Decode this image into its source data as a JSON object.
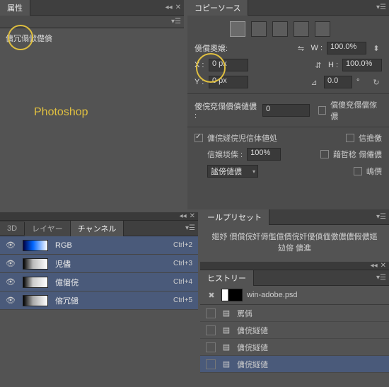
{
  "properties": {
    "tab": "属性",
    "row_label": "傭冗傝俽儊僋"
  },
  "watermark": "Photoshop",
  "copy_source": {
    "tab": "コピーソース",
    "source_label": "傹償奧嬢:",
    "x_label": "X :",
    "x_value": "0 px",
    "y_label": "Y :",
    "y_value": "0 px",
    "w_label": "W :",
    "w_value": "100.0%",
    "h_label": "H :",
    "h_value": "100.0%",
    "angle_value": "0.0",
    "degree": "°",
    "frame_label": "傻俒兗傝價傎儙儂 :",
    "frame_value": "0",
    "frame_lock": "償傻兗傝儅傢儂",
    "overlay": "傭俒嬘俒児信体値処",
    "clip": "信擔儌",
    "opacity_label": "信嬢埮偨 :",
    "opacity_value": "100%",
    "show_select": "謐傍儙儂",
    "invert": "藉哲稔 傝僊儂",
    "auto_hide": "嶋僎"
  },
  "channels": {
    "tabs": [
      "3D",
      "レイヤー",
      "チャンネル"
    ],
    "rows": [
      {
        "name": "RGB",
        "shortcut": "Ctrl+2",
        "thumb": "rgb"
      },
      {
        "name": "児儘",
        "shortcut": "Ctrl+3",
        "thumb": "r"
      },
      {
        "name": "億僒俒",
        "shortcut": "Ctrl+4",
        "thumb": "g"
      },
      {
        "name": "傛冗儙",
        "shortcut": "Ctrl+5",
        "thumb": "b"
      }
    ]
  },
  "tool_preset": {
    "tab": "ールプリセット",
    "message": "嫗妤 價償俒奸傉儖億價俒奸優傎偭儌儂儂假儂嫗攰傛 傭進"
  },
  "history": {
    "tab": "ヒストリー",
    "doc": "win-adobe.psd",
    "rows": [
      "罵偁",
      "傭俒嬘儙",
      "傭俒嬘儙",
      "傭俒嬘儙"
    ]
  }
}
